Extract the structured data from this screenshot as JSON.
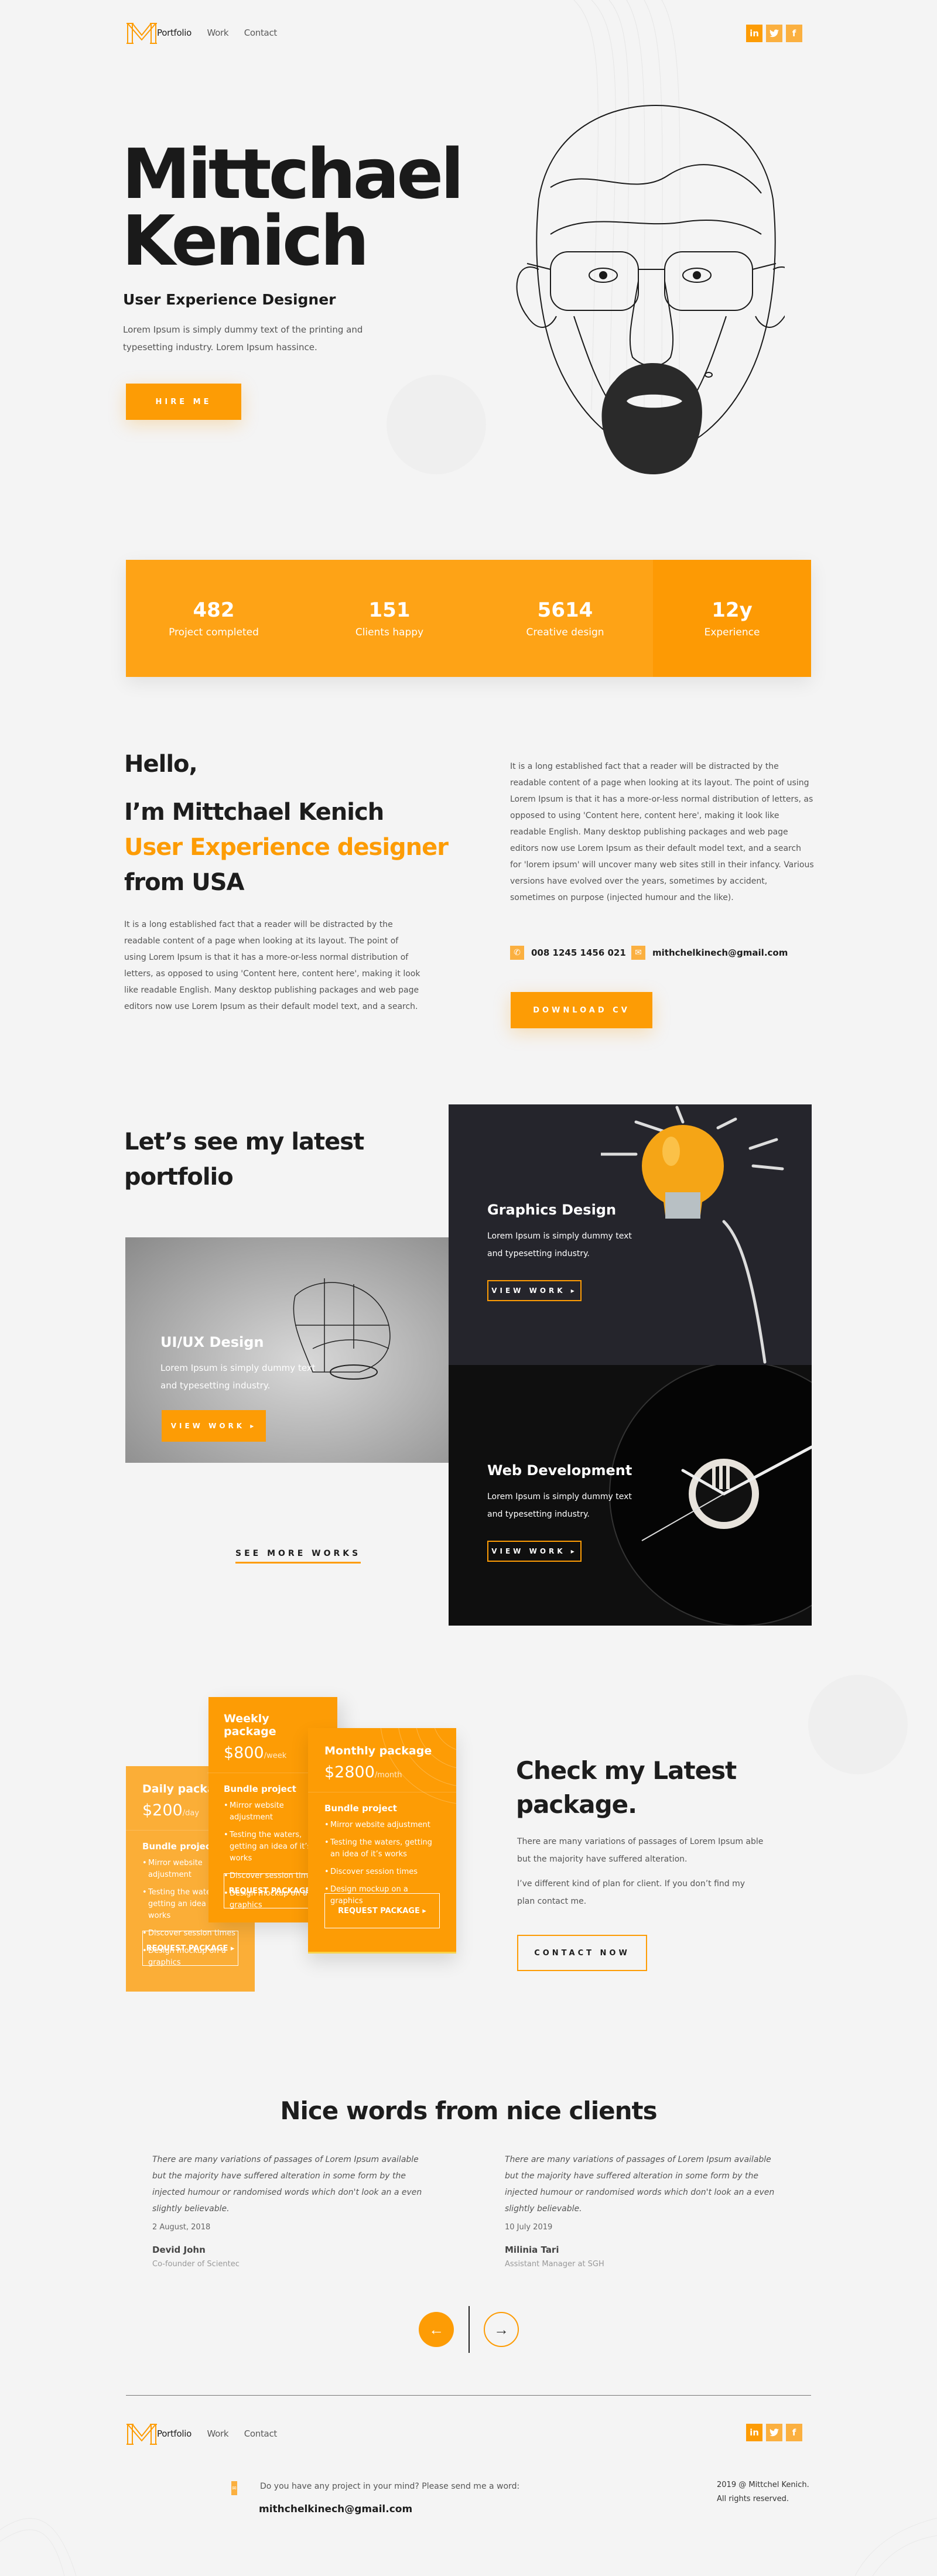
{
  "header": {
    "logo": "MM monogram",
    "nav": [
      {
        "label": "Portfolio",
        "active": true
      },
      {
        "label": "Work",
        "active": false
      },
      {
        "label": "Contact",
        "active": false
      }
    ],
    "social": [
      {
        "icon": "linkedin-icon",
        "glyph": "in"
      },
      {
        "icon": "twitter-icon",
        "glyph": "🐦"
      },
      {
        "icon": "facebook-icon",
        "glyph": "f"
      }
    ]
  },
  "hero": {
    "name_line1": "Mittchael",
    "name_line2": "Kenich",
    "role": "User Experience Designer",
    "desc_line1": "Lorem Ipsum is simply dummy text of the printing and",
    "desc_line2": "typesetting industry. Lorem Ipsum hassince.",
    "cta": "HIRE ME"
  },
  "stats": [
    {
      "value": "482",
      "label": "Project completed"
    },
    {
      "value": "151",
      "label": "Clients happy"
    },
    {
      "value": "5614",
      "label": "Creative design"
    },
    {
      "value": "12y",
      "label": "Experience"
    }
  ],
  "about": {
    "hello": "Hello,",
    "im": "I’m Mittchael Kenich",
    "role": "User Experience designer",
    "from": "from USA",
    "left_para": "It is a long established fact that a reader will be distracted by the readable content of a page when looking at its layout. The point of using Lorem Ipsum is that it has a more-or-less normal distribution of letters, as opposed to using 'Content here, content here', making it look like readable English. Many desktop publishing packages and web page editors now use Lorem Ipsum as their default model text, and a search.",
    "right_para": "It is a long established fact that a reader will be distracted by the readable content of a page when looking at its layout. The point of using Lorem Ipsum is that it has a more-or-less normal distribution of letters, as opposed to using 'Content here, content here', making it look like readable English. Many desktop publishing packages and web page editors now use Lorem Ipsum as their default model text, and a search for 'lorem ipsum' will uncover many web sites still in their infancy. Various versions have evolved over the years, sometimes by accident, sometimes on purpose (injected humour and the like).",
    "phone": "008 1245 1456 021",
    "email": "mithchelkinech@gmail.com",
    "cta": "DOWNLOAD CV"
  },
  "portfolio": {
    "heading_line1": "Let’s see my latest",
    "heading_line2": "portfolio",
    "cards": [
      {
        "title": "Graphics Design",
        "desc_line1": "Lorem Ipsum is simply dummy text",
        "desc_line2": "and typesetting industry.",
        "cta": "VIEW WORK ▸"
      },
      {
        "title": "UI/UX Design",
        "desc_line1": "Lorem Ipsum is simply dummy text",
        "desc_line2": "and typesetting industry.",
        "cta": "VIEW WORK ▸"
      },
      {
        "title": "Web Development",
        "desc_line1": "Lorem Ipsum is simply dummy text",
        "desc_line2": "and typesetting industry.",
        "cta": "VIEW WORK ▸"
      }
    ],
    "see_more": "SEE MORE WORKS"
  },
  "packages": {
    "items": [
      {
        "name": "Daily package",
        "price": "$200",
        "period": "/day",
        "bundle": "Bundle project",
        "features": [
          "Mirror website adjustment",
          "Testing the waters, getting an idea of it’s works",
          "Discover session times",
          "Design mockup on a graphics"
        ],
        "cta": "REQUEST PACKAGE ▸"
      },
      {
        "name": "Weekly package",
        "price": "$800",
        "period": "/week",
        "bundle": "Bundle project",
        "features": [
          "Mirror website adjustment",
          "Testing the waters, getting an idea of it’s works",
          "Discover session times",
          "Design mockup on a graphics"
        ],
        "cta": "REQUEST PACKAGE ▸"
      },
      {
        "name": "Monthly package",
        "price": "$2800",
        "period": "/month",
        "bundle": "Bundle project",
        "features": [
          "Mirror website adjustment",
          "Testing the waters, getting an idea of it’s works",
          "Discover session times",
          "Design mockup on a graphics"
        ],
        "cta": "REQUEST PACKAGE ▸"
      }
    ],
    "heading_line1": "Check my Latest",
    "heading_line2": "package.",
    "desc": "There are many variations of passages of Lorem Ipsum able but the majority have suffered alteration.",
    "note": "I’ve different kind of plan for client. If you don’t find my plan contact me.",
    "cta": "CONTACT NOW"
  },
  "testimonials": {
    "heading": "Nice words from nice clients",
    "items": [
      {
        "quote": "There are many variations of passages of Lorem Ipsum available but the majority have suffered alteration in some form by the injected humour or randomised words which don't look an a even slightly believable.",
        "date": "2 August, 2018",
        "name": "Devid John",
        "role": "Co-founder of Scientec"
      },
      {
        "quote": "There are many variations of passages of Lorem Ipsum available but the majority have suffered alteration in some form by the injected humour or randomised words which don't look an a even slightly believable.",
        "date": "10 July 2019",
        "name": "Milinia Tari",
        "role": "Assistant Manager at SGH"
      }
    ],
    "prev": "←",
    "next": "→"
  },
  "footer": {
    "prompt": "Do you have any project in your mind? Please send me a word:",
    "email": "mithchelkinech@gmail.com",
    "copyright_line1": "2019 @ Mittchel Kenich.",
    "copyright_line2": "All rights reserved."
  },
  "colors": {
    "accent": "#fd9c05",
    "accent_light": "#fbb040",
    "bg": "#f4f4f4",
    "text": "#1d1d1d"
  }
}
